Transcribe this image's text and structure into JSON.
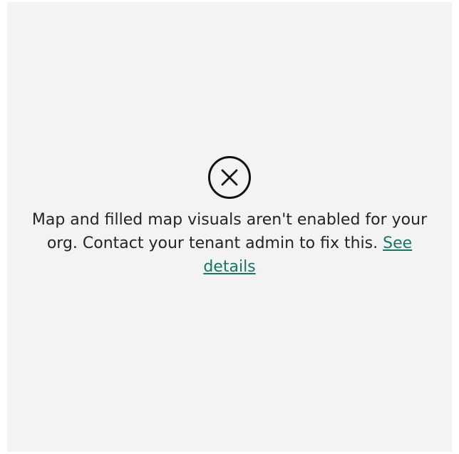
{
  "error": {
    "icon": "error-circle-x-icon",
    "message": "Map and filled map visuals aren't enabled for your org. Contact your tenant admin to fix this.",
    "link_label": "See details"
  },
  "colors": {
    "panel_background": "#f3f3f3",
    "text": "#252423",
    "link": "#117865"
  }
}
